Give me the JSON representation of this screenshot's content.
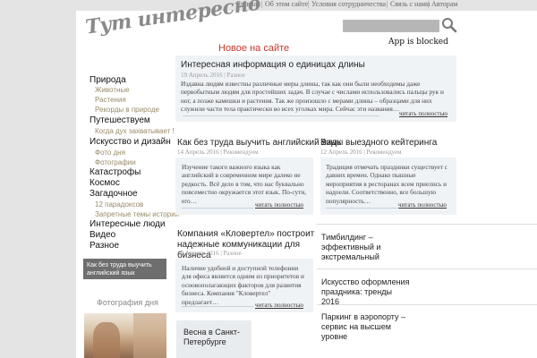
{
  "topnav": {
    "items": [
      "Главная",
      "Об этом сайте",
      "Условия сотрудничества",
      "Связь с нами",
      "Авторам"
    ]
  },
  "logo": {
    "text": "Тут интересно"
  },
  "search": {
    "placeholder": ""
  },
  "blocked_text": "App is blocked",
  "section_title": "Новое на сайте",
  "sidebar": {
    "items": [
      {
        "label": "Природа",
        "level": 1
      },
      {
        "label": "Животные",
        "level": 2
      },
      {
        "label": "Растения",
        "level": 2
      },
      {
        "label": "Рекорды в природе",
        "level": 2
      },
      {
        "label": "Путешествуем",
        "level": 1
      },
      {
        "label": "Когда дух захватывает !",
        "level": 2
      },
      {
        "label": "Искусство и дизайн",
        "level": 1
      },
      {
        "label": "Фото дня",
        "level": 2
      },
      {
        "label": "Фотографии",
        "level": 2
      },
      {
        "label": "Катастрофы",
        "level": 1
      },
      {
        "label": "Космос",
        "level": 1
      },
      {
        "label": "Загадочное",
        "level": 1
      },
      {
        "label": "12 парадоксов",
        "level": 2
      },
      {
        "label": "Запретные темы истории",
        "level": 2
      },
      {
        "label": "Интересные люди",
        "level": 1
      },
      {
        "label": "Видео",
        "level": 1
      },
      {
        "label": "Разное",
        "level": 1
      }
    ],
    "banner": "Как без труда выучить английский язык",
    "photo_title": "Фотография дня"
  },
  "articles": {
    "featured": {
      "title": "Интересная информация о единицах длины",
      "meta": "19 Апрель 2016 | Разное",
      "excerpt": "Издавна людям известны различные меры длины, так как они были необходимы даже первобытным людям для простейших задач. В случае с числами использовались пальцы рук и ног, а позже камешки и растения. Так же произошло с мерами длины – образцами для них служили части тела практически во всех уголках мира. Сейчас эти названия…",
      "more": "читать полностью"
    },
    "english": {
      "title": "Как без труда выучить английский язык",
      "meta": "14 Апрель 2016 | Рекомендуем",
      "excerpt": "Изучение такого важного языка как английский в современном мире далеко не редкость. Всё дело в том, что нас буквально повсеместно окружается этот язык. По-сути, его…",
      "more": "читать полностью"
    },
    "catering": {
      "title": "Виды выездного кейтеринга",
      "meta": "12 Апрель 2016 | Рекомендуем",
      "excerpt": "Традиция отмечать праздники существует с давних времен. Однако пышные мероприятия в ресторанах всем приелись и надоели. Соответственно, все большую популярность…",
      "more": "читать полностью"
    },
    "kloverel": {
      "title": "Компания «Кловертел» построит надежные коммуникации для бизнеса",
      "meta": "12 Апрель 2016 | Разное",
      "excerpt": "Наличие удобной и доступной телефонии для офиса является одним из приоритетов и основополагающих факторов для развития бизнеса. Компания \"Кловертел\" предлагает…",
      "more": "читать полностью"
    }
  },
  "side_links": [
    "Тимбилдинг – эффективный и экстремальный",
    "Искусство оформления праздника: тренды 2016",
    "Паркинг в аэропорту – сервис на высшем уровне"
  ],
  "bottom_card": "Весна в Санкт-Петербурге",
  "colors": {
    "accent": "#c0392b",
    "card_bg": "#f0f3f6",
    "sub_link": "#9a8a6a"
  }
}
